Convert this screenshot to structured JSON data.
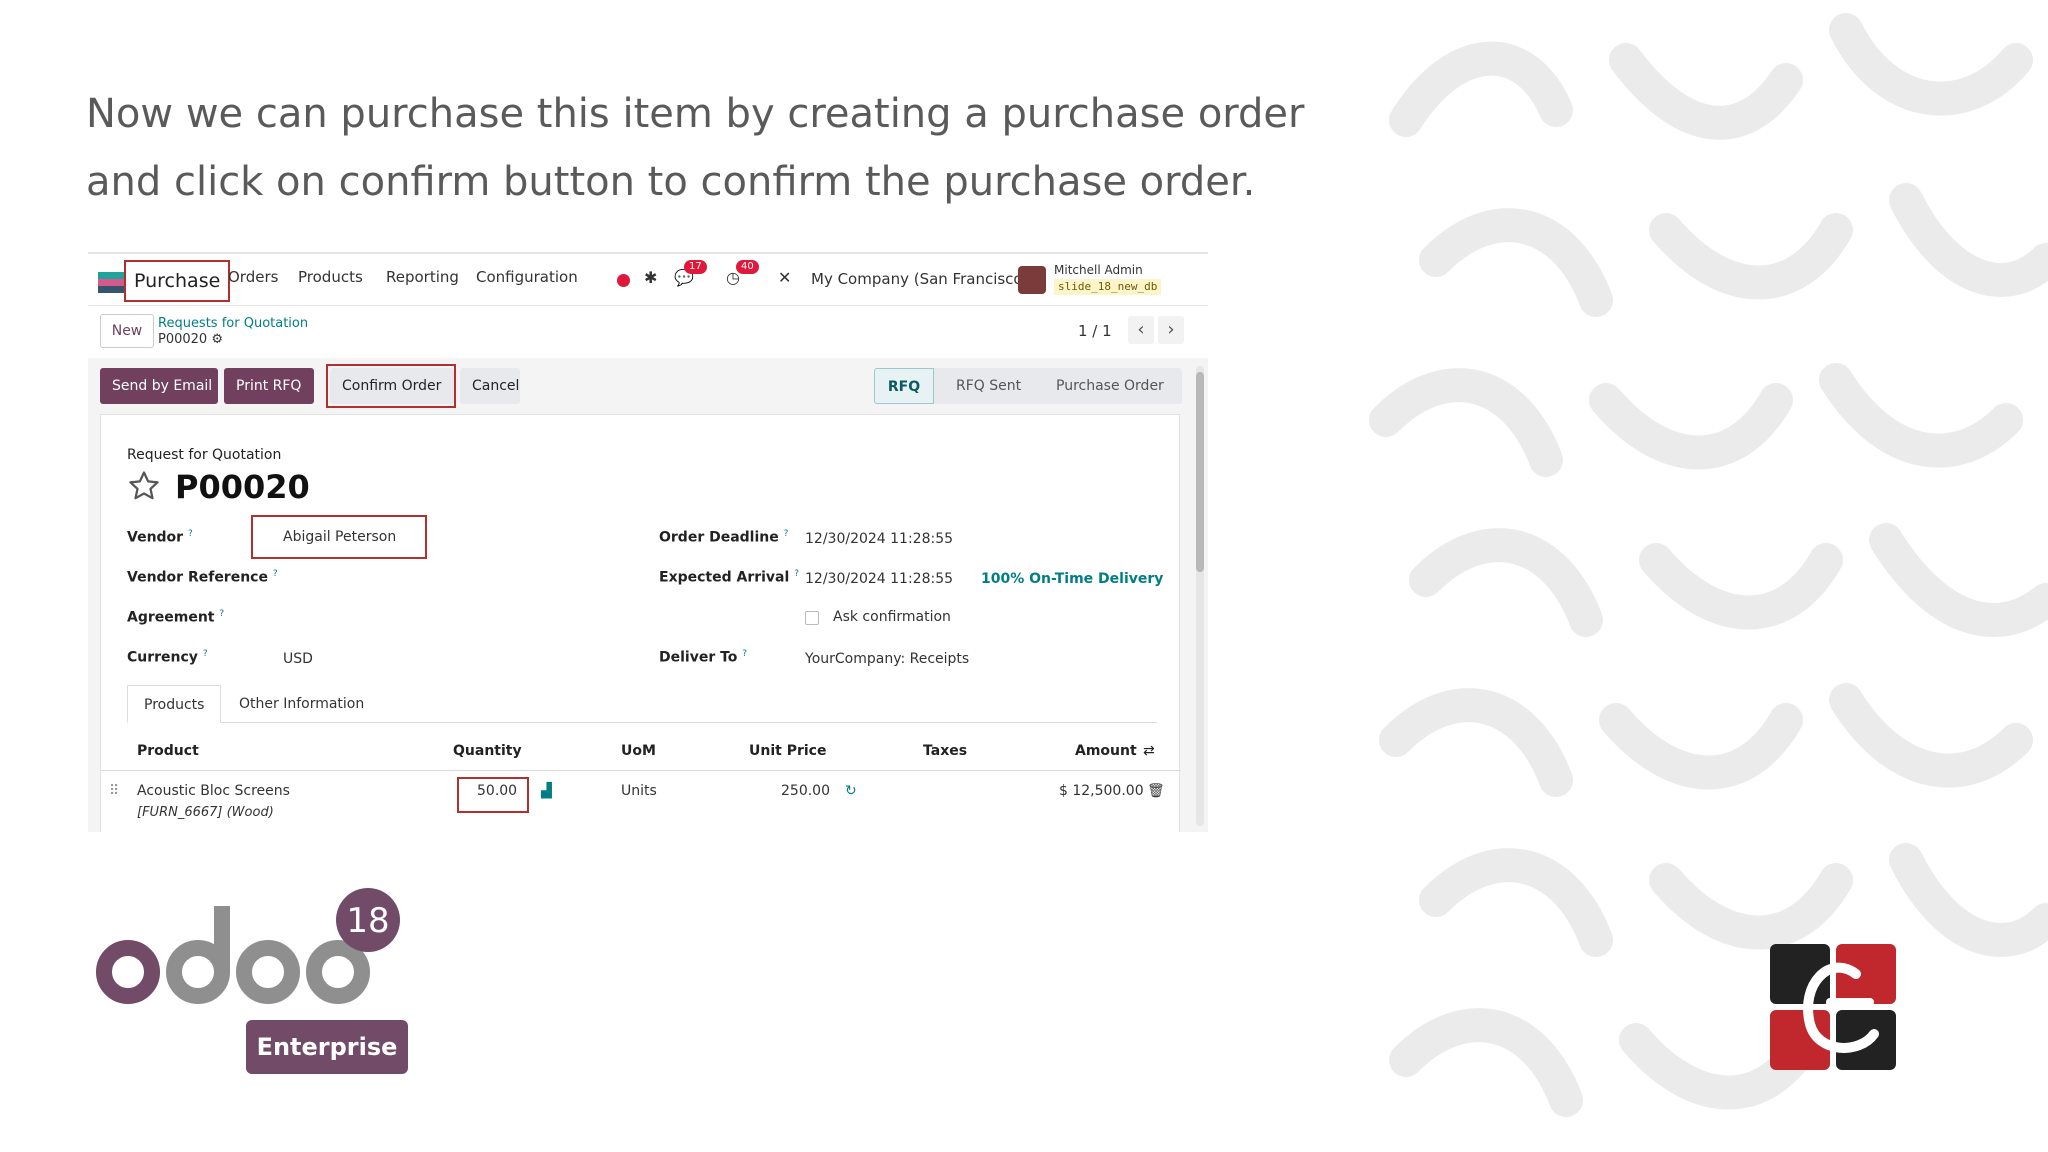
{
  "slide": {
    "caption": "Now we can purchase this item by creating a purchase order and click on confirm button to confirm the purchase order."
  },
  "navbar": {
    "app_name": "Purchase",
    "menu": [
      "Orders",
      "Products",
      "Reporting",
      "Configuration"
    ],
    "chat_count": "17",
    "activity_count": "40",
    "company": "My Company (San Francisco)",
    "user_name": "Mitchell Admin",
    "db_name": "slide_18_new_db"
  },
  "breadcrumb": {
    "new_label": "New",
    "parent": "Requests for Quotation",
    "record": "P00020",
    "pager": "1 / 1"
  },
  "actions": {
    "send_email": "Send by Email",
    "print_rfq": "Print RFQ",
    "confirm_order": "Confirm Order",
    "cancel": "Cancel"
  },
  "status": {
    "steps": [
      "RFQ",
      "RFQ Sent",
      "Purchase Order"
    ],
    "active": "RFQ"
  },
  "form": {
    "subtitle": "Request for Quotation",
    "title": "P00020",
    "vendor_label": "Vendor",
    "vendor_value": "Abigail Peterson",
    "vendor_ref_label": "Vendor Reference",
    "agreement_label": "Agreement",
    "currency_label": "Currency",
    "currency_value": "USD",
    "order_deadline_label": "Order Deadline",
    "order_deadline_value": "12/30/2024 11:28:55",
    "expected_arrival_label": "Expected Arrival",
    "expected_arrival_value": "12/30/2024 11:28:55",
    "on_time": "100% On-Time Delivery",
    "ask_confirmation": "Ask confirmation",
    "deliver_to_label": "Deliver To",
    "deliver_to_value": "YourCompany: Receipts",
    "help_mark": "?"
  },
  "tabs": [
    "Products",
    "Other Information"
  ],
  "lines": {
    "headers": [
      "Product",
      "Quantity",
      "UoM",
      "Unit Price",
      "Taxes",
      "Amount"
    ],
    "rows": [
      {
        "product": "Acoustic Bloc Screens",
        "variant": "[FURN_6667] (Wood)",
        "quantity": "50.00",
        "uom": "Units",
        "unit_price": "250.00",
        "taxes": "",
        "amount": "$ 12,500.00"
      }
    ]
  },
  "branding": {
    "version": "18",
    "edition": "Enterprise"
  },
  "colors": {
    "brand_purple": "#714b67",
    "highlight_red": "#b03030",
    "teal": "#017e84"
  }
}
